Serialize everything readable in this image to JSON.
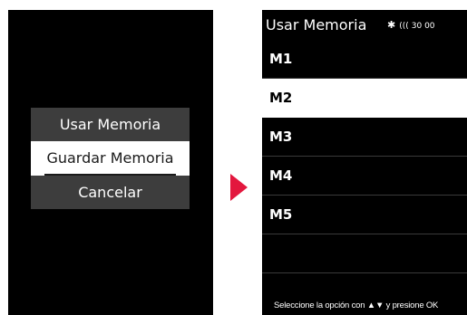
{
  "left_popup": {
    "items": [
      {
        "label": "Usar Memoria"
      },
      {
        "label": "Guardar Memoria"
      },
      {
        "label": "Cancelar"
      }
    ]
  },
  "right_screen": {
    "title": "Usar Memoria",
    "status": {
      "bluetooth_icon": "bluetooth-icon",
      "signal_icon": "signal-icon",
      "value": "30 00"
    },
    "rows": [
      {
        "label": "M1"
      },
      {
        "label": "M2"
      },
      {
        "label": "M3"
      },
      {
        "label": "M4"
      },
      {
        "label": "M5"
      }
    ],
    "footer": "Seleccione la opción con ▲▼ y presione OK"
  },
  "colors": {
    "accent_arrow": "#e3173e",
    "popup_bg": "#3d3d3d",
    "selected_bg": "#ffffff"
  }
}
